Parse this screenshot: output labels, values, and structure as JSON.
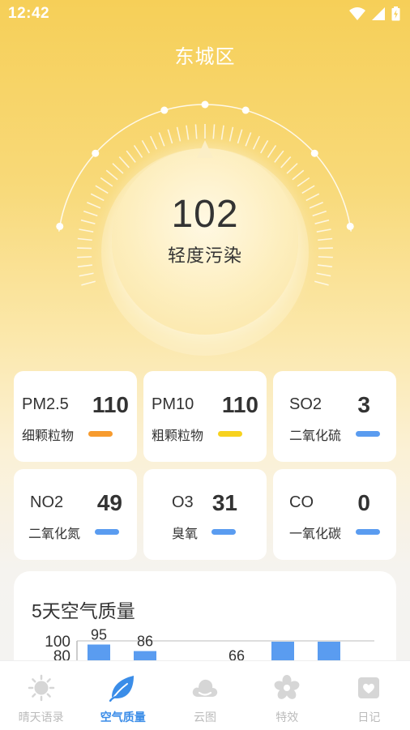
{
  "status_bar": {
    "time": "12:42"
  },
  "city": "东城区",
  "aqi": {
    "value": "102",
    "level": "轻度污染"
  },
  "pollutants": [
    {
      "name": "PM2.5",
      "value": "110",
      "desc": "细颗粒物",
      "color": "#f79b2e"
    },
    {
      "name": "PM10",
      "value": "110",
      "desc": "粗颗粒物",
      "color": "#f7d21e"
    },
    {
      "name": "SO2",
      "value": "3",
      "desc": "二氧化硫",
      "color": "#5a9cf0"
    },
    {
      "name": "NO2",
      "value": "49",
      "desc": "二氧化氮",
      "color": "#5a9cf0"
    },
    {
      "name": "O3",
      "value": "31",
      "desc": "臭氧",
      "color": "#5a9cf0"
    },
    {
      "name": "CO",
      "value": "0",
      "desc": "一氧化碳",
      "color": "#5a9cf0"
    }
  ],
  "forecast": {
    "title": "5天空气质量"
  },
  "chart_data": {
    "type": "bar",
    "y_tick_labels": [
      "100",
      "80"
    ],
    "values": [
      95,
      86,
      66,
      null,
      null
    ],
    "data_labels": [
      "95",
      "86",
      "66",
      "",
      ""
    ],
    "bar_color": "#5a9cf0",
    "ylim": [
      0,
      100
    ]
  },
  "nav": {
    "items": [
      {
        "label": "晴天语录",
        "icon": "sun-icon",
        "active": false
      },
      {
        "label": "空气质量",
        "icon": "leaf-icon",
        "active": true
      },
      {
        "label": "云图",
        "icon": "cloud-icon",
        "active": false
      },
      {
        "label": "特效",
        "icon": "flower-icon",
        "active": false
      },
      {
        "label": "日记",
        "icon": "diary-icon",
        "active": false
      }
    ],
    "active_color": "#3b8de8",
    "inactive_color": "#cccccc"
  }
}
